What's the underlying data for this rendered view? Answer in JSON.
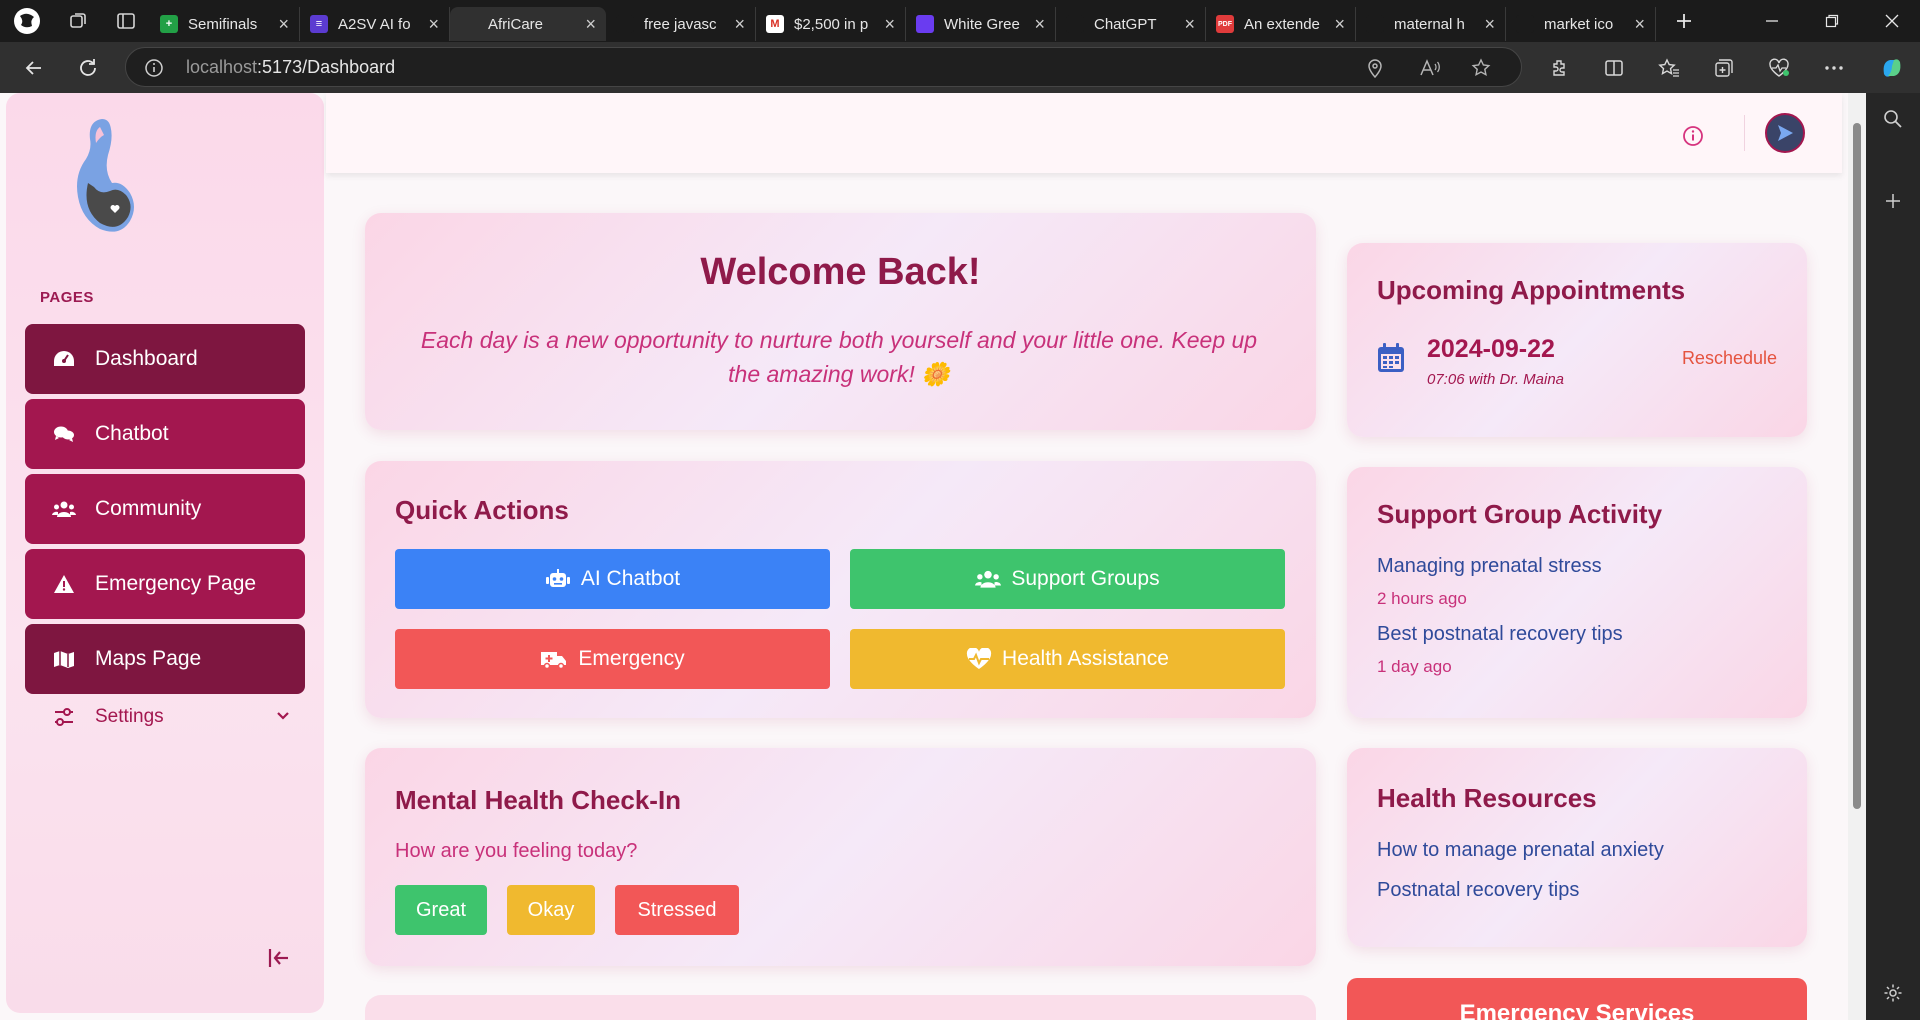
{
  "browser": {
    "tabs": [
      {
        "label": "Semifinals",
        "fav_color": "#22a046",
        "fav_glyph": "+",
        "active": false
      },
      {
        "label": "A2SV AI fo",
        "fav_color": "#5b3bd1",
        "fav_glyph": "≡",
        "active": false
      },
      {
        "label": "AfriCare",
        "fav_color": "#303030",
        "fav_glyph": "",
        "active": true
      },
      {
        "label": "free javasc",
        "fav_color": "#1b1b1b",
        "fav_glyph": "",
        "active": false
      },
      {
        "label": "$2,500 in p",
        "fav_color": "#ffffff",
        "fav_glyph": "M",
        "active": false
      },
      {
        "label": "White Gree",
        "fav_color": "#6a3cf0",
        "fav_glyph": "",
        "active": false
      },
      {
        "label": "ChatGPT",
        "fav_color": "#1b1b1b",
        "fav_glyph": "",
        "active": false
      },
      {
        "label": "An extende",
        "fav_color": "#e03b3b",
        "fav_glyph": "PDF",
        "active": false
      },
      {
        "label": "maternal h",
        "fav_color": "#1b1b1b",
        "fav_glyph": "",
        "active": false
      },
      {
        "label": "market ico",
        "fav_color": "#1b1b1b",
        "fav_glyph": "",
        "active": false
      }
    ],
    "url_host": "localhost",
    "url_path": ":5173/Dashboard"
  },
  "sidebar": {
    "section_label": "PAGES",
    "items": [
      {
        "label": "Dashboard",
        "icon": "dashboard-icon"
      },
      {
        "label": "Chatbot",
        "icon": "chat-icon"
      },
      {
        "label": "Community",
        "icon": "users-icon"
      },
      {
        "label": "Emergency Page",
        "icon": "warning-icon"
      },
      {
        "label": "Maps Page",
        "icon": "map-icon"
      }
    ],
    "settings_label": "Settings"
  },
  "welcome": {
    "title": "Welcome Back!",
    "message": "Each day is a new opportunity to nurture both yourself and your little one. Keep up the amazing work! 🌼"
  },
  "quick_actions": {
    "title": "Quick Actions",
    "buttons": [
      {
        "label": "AI Chatbot",
        "color": "#3b82f6",
        "icon": "robot-icon"
      },
      {
        "label": "Support Groups",
        "color": "#3ec46d",
        "icon": "users-icon"
      },
      {
        "label": "Emergency",
        "color": "#f25757",
        "icon": "ambulance-icon"
      },
      {
        "label": "Health Assistance",
        "color": "#f0b92f",
        "icon": "heartbeat-icon"
      }
    ]
  },
  "mental_health": {
    "title": "Mental Health Check-In",
    "question": "How are you feeling today?",
    "moods": [
      {
        "label": "Great",
        "color": "#3ec46d"
      },
      {
        "label": "Okay",
        "color": "#f0b92f"
      },
      {
        "label": "Stressed",
        "color": "#f25757"
      }
    ]
  },
  "appointments": {
    "title": "Upcoming Appointments",
    "date": "2024-09-22",
    "detail": "07:06 with Dr. Maina",
    "action": "Reschedule"
  },
  "support_activity": {
    "title": "Support Group Activity",
    "items": [
      {
        "topic": "Managing prenatal stress",
        "time": "2 hours ago"
      },
      {
        "topic": "Best postnatal recovery tips",
        "time": "1 day ago"
      }
    ]
  },
  "resources": {
    "title": "Health Resources",
    "links": [
      "How to manage prenatal anxiety",
      "Postnatal recovery tips"
    ]
  },
  "emergency_services": {
    "title": "Emergency Services"
  },
  "colors": {
    "brand": "#a3174f",
    "brand_dark": "#7e1640",
    "accent_pink": "#c8317a"
  }
}
